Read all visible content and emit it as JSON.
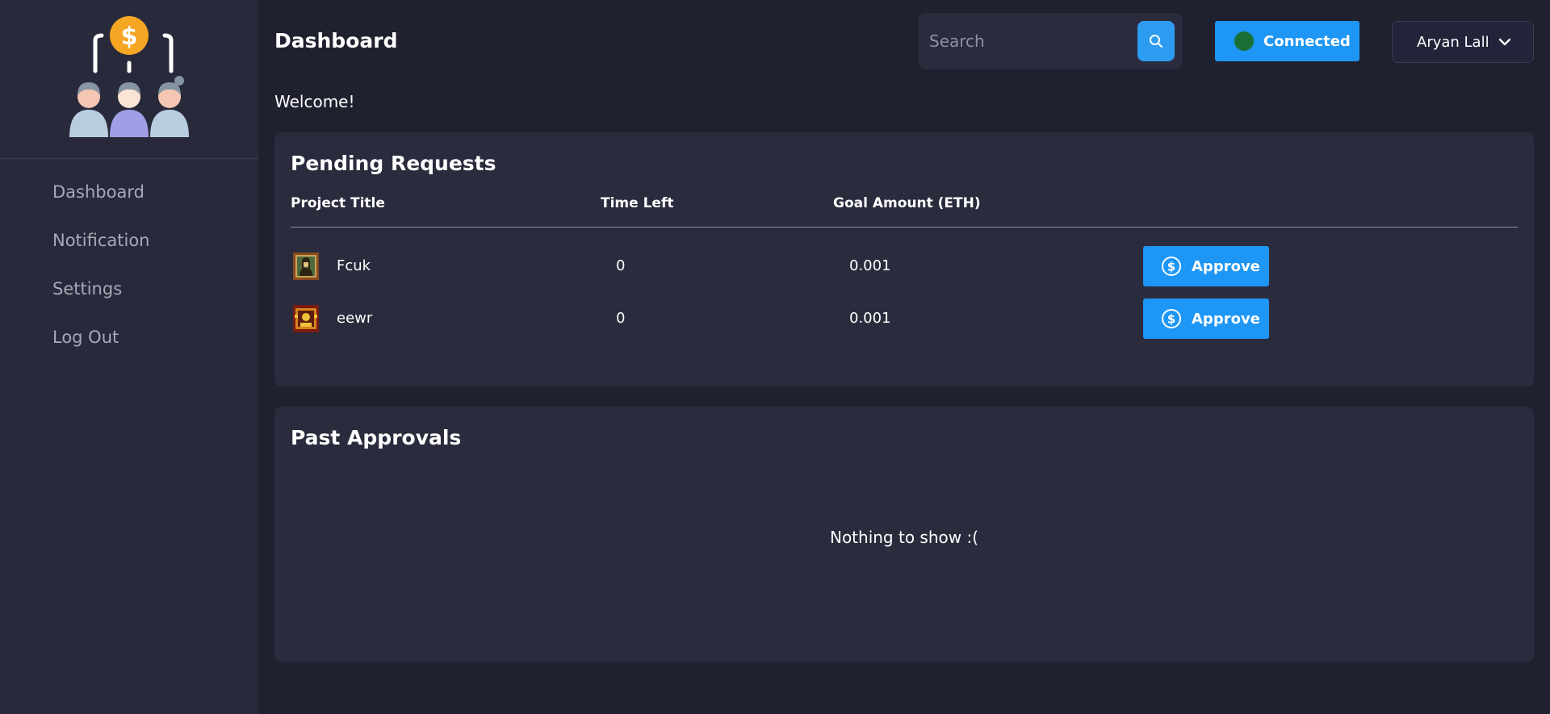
{
  "sidebar": {
    "items": [
      {
        "label": "Dashboard"
      },
      {
        "label": "Notification"
      },
      {
        "label": "Settings"
      },
      {
        "label": "Log Out"
      }
    ]
  },
  "header": {
    "title": "Dashboard",
    "search_placeholder": "Search",
    "search_value": "",
    "connection_label": "Connected",
    "user_name": "Aryan Lall"
  },
  "welcome": "Welcome!",
  "pending": {
    "title": "Pending Requests",
    "columns": [
      "Project Title",
      "Time Left",
      "Goal Amount (ETH)"
    ],
    "rows": [
      {
        "title": "Fcuk",
        "time_left": "0",
        "goal": "0.001",
        "action": "Approve"
      },
      {
        "title": "eewr",
        "time_left": "0",
        "goal": "0.001",
        "action": "Approve"
      }
    ]
  },
  "past": {
    "title": "Past Approvals",
    "empty_message": "Nothing to show :("
  },
  "colors": {
    "background": "#20212f",
    "sidebar": "#282a3b",
    "card": "#2a2c3d",
    "accent": "#1e96f5",
    "status_online": "#1a6e34",
    "coin": "#f5a623"
  }
}
